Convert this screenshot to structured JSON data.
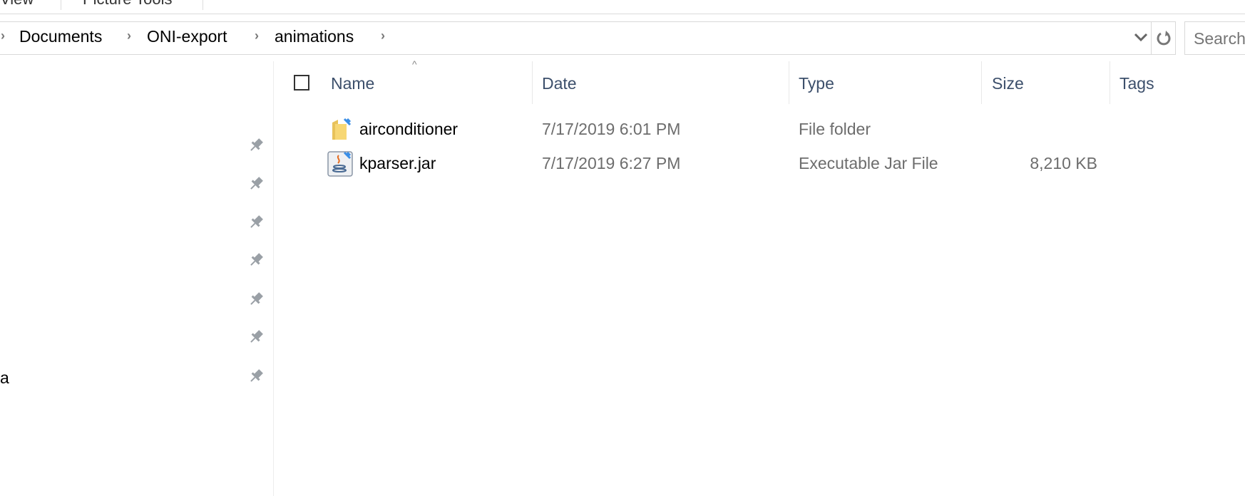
{
  "ribbon": {
    "tabs": [
      "View",
      "Picture Tools"
    ]
  },
  "address_bar": {
    "breadcrumb": [
      "Documents",
      "ONI-export",
      "animations"
    ],
    "dropdown_icon": "chevron-down-icon",
    "refresh_icon": "refresh-icon"
  },
  "search": {
    "placeholder": "Search"
  },
  "nav_pane": {
    "pinned_count": 7,
    "partial_label": "a",
    "pin_icon": "pin-icon"
  },
  "columns": {
    "name": "Name",
    "date": "Date",
    "type": "Type",
    "size": "Size",
    "tags": "Tags",
    "sorted_by": "Name"
  },
  "files": [
    {
      "name": "airconditioner",
      "date": "7/17/2019 6:01 PM",
      "type": "File folder",
      "size": "",
      "icon": "folder-icon"
    },
    {
      "name": "kparser.jar",
      "date": "7/17/2019 6:27 PM",
      "type": "Executable Jar File",
      "size": "8,210 KB",
      "icon": "java-jar-icon"
    }
  ]
}
